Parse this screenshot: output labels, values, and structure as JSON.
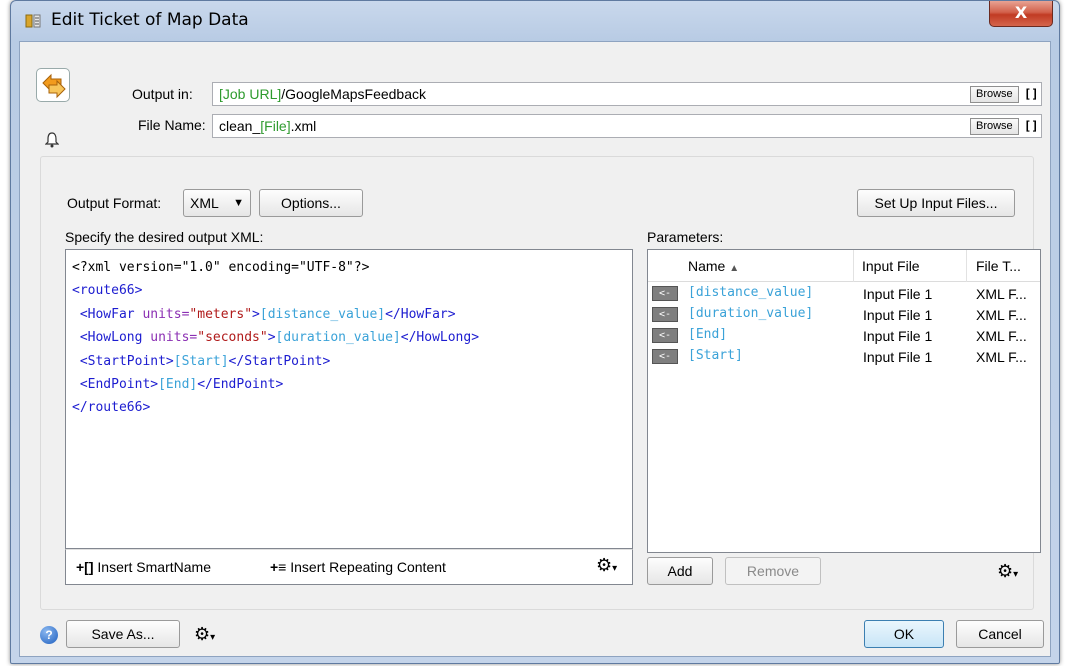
{
  "window": {
    "title": "Edit Ticket of Map Data",
    "close_label": "X"
  },
  "output": {
    "output_in_label": "Output in:",
    "output_in_value_green": "[Job URL]",
    "output_in_value_rest": "/GoogleMapsFeedback",
    "file_name_label": "File Name:",
    "file_name_value_prefix": "clean_",
    "file_name_value_green": "[File]",
    "file_name_value_suffix": ".xml",
    "browse_label": "Browse",
    "smartname_label": "[]"
  },
  "format": {
    "label": "Output Format:",
    "selected": "XML",
    "options_button": "Options...",
    "setup_button": "Set Up Input Files..."
  },
  "editor": {
    "label": "Specify the desired output XML:",
    "insert_smartname": "Insert SmartName",
    "insert_repeating": "Insert Repeating Content",
    "lines": [
      [
        {
          "t": "<?xml version=\"1.0\" encoding=\"UTF-8\"?>",
          "c": "pi"
        }
      ],
      [
        {
          "t": "<route66>",
          "c": "tag"
        }
      ],
      [
        {
          "t": " <HowFar ",
          "c": "tag"
        },
        {
          "t": "units=",
          "c": "attr"
        },
        {
          "t": "\"meters\"",
          "c": "val"
        },
        {
          "t": ">",
          "c": "tag"
        },
        {
          "t": "[distance_value]",
          "c": "sn"
        },
        {
          "t": "</HowFar>",
          "c": "tag"
        }
      ],
      [
        {
          "t": " <HowLong ",
          "c": "tag"
        },
        {
          "t": "units=",
          "c": "attr"
        },
        {
          "t": "\"seconds\"",
          "c": "val"
        },
        {
          "t": ">",
          "c": "tag"
        },
        {
          "t": "[duration_value]",
          "c": "sn"
        },
        {
          "t": "</HowLong>",
          "c": "tag"
        }
      ],
      [
        {
          "t": " <StartPoint>",
          "c": "tag"
        },
        {
          "t": "[Start]",
          "c": "sn"
        },
        {
          "t": "</StartPoint>",
          "c": "tag"
        }
      ],
      [
        {
          "t": " <EndPoint>",
          "c": "tag"
        },
        {
          "t": "[End]",
          "c": "sn"
        },
        {
          "t": "</EndPoint>",
          "c": "tag"
        }
      ],
      [
        {
          "t": "</route66>",
          "c": "tag"
        }
      ]
    ]
  },
  "params": {
    "label": "Parameters:",
    "col_name": "Name",
    "col_input": "Input File",
    "col_type": "File T...",
    "arrow_label": "<-",
    "rows": [
      {
        "name": "[distance_value]",
        "input": "Input File 1",
        "type": "XML F..."
      },
      {
        "name": "[duration_value]",
        "input": "Input File 1",
        "type": "XML F..."
      },
      {
        "name": "[End]",
        "input": "Input File 1",
        "type": "XML F..."
      },
      {
        "name": "[Start]",
        "input": "Input File 1",
        "type": "XML F..."
      }
    ],
    "add_button": "Add",
    "remove_button": "Remove"
  },
  "footer": {
    "help": "?",
    "save_as": "Save As...",
    "ok": "OK",
    "cancel": "Cancel"
  },
  "colors": {
    "smartname_green": "#2e9b2e",
    "xml_tag": "#1c1cd0",
    "xml_attr": "#8b2fb3",
    "xml_value": "#b01a1a",
    "smartname_blue": "#3aa2d8"
  }
}
